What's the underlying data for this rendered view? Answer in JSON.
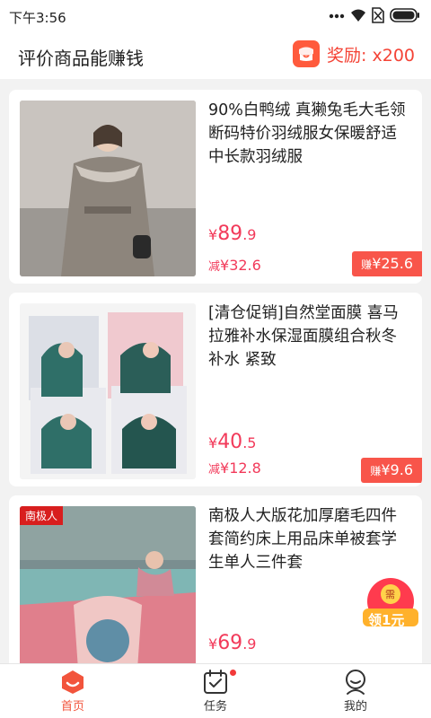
{
  "status": {
    "time": "下午3:56"
  },
  "header": {
    "title": "评价商品能赚钱",
    "reward": "奖励: x200"
  },
  "products": [
    {
      "title": "90%白鸭绒  真獭兔毛大毛领断码特价羽绒服女保暖舒适中长款羽绒服",
      "price_yen": "¥",
      "price_int": "89",
      "price_dec": ".9",
      "discount_label": "减",
      "discount": "¥32.6",
      "earn_label": "赚",
      "earn": "¥25.6"
    },
    {
      "title": "[清仓促销]自然堂面膜  喜马拉雅补水保湿面膜组合秋冬补水 紧致",
      "price_yen": "¥",
      "price_int": "40",
      "price_dec": ".5",
      "discount_label": "减",
      "discount": "¥12.8",
      "earn_label": "赚",
      "earn": "¥9.6"
    },
    {
      "title": "南极人大版花加厚磨毛四件套简约床上用品床单被套学生单人三件套",
      "price_yen": "¥",
      "price_int": "69",
      "price_dec": ".9",
      "brand": "南极人",
      "coupon_top": "需",
      "coupon_main": "领1元"
    }
  ],
  "tabbar": [
    {
      "label": "首页",
      "icon": "home-icon",
      "active": true
    },
    {
      "label": "任务",
      "icon": "calendar-check-icon",
      "badge": true
    },
    {
      "label": "我的",
      "icon": "user-icon"
    }
  ],
  "colors": {
    "accent": "#f23a5a",
    "earn_bg": "#f8554a",
    "tab_active": "#f2543c"
  }
}
